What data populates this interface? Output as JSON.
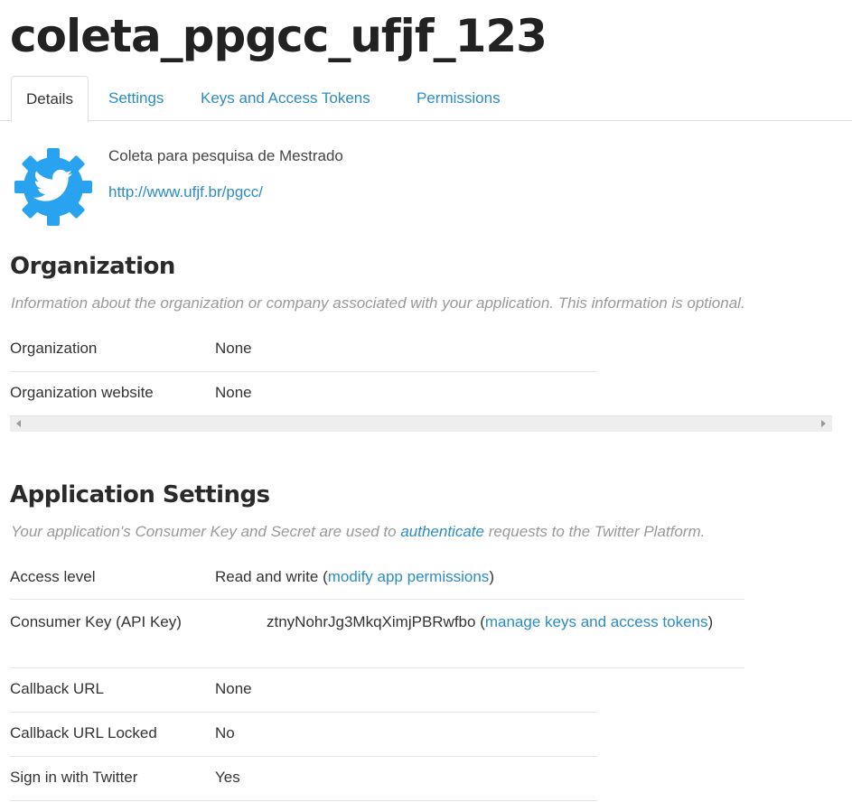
{
  "app": {
    "title": "coleta_ppgcc_ufjf_123"
  },
  "tabs": [
    {
      "label": "Details"
    },
    {
      "label": "Settings"
    },
    {
      "label": "Keys and Access Tokens"
    },
    {
      "label": "Permissions"
    }
  ],
  "details": {
    "description": "Coleta para pesquisa de Mestrado",
    "website": "http://www.ufjf.br/pgcc/",
    "logo_icon": "twitter-bird-gear-icon",
    "logo_color": "#29a3ef"
  },
  "organization": {
    "heading": "Organization",
    "note": "Information about the organization or company associated with your application. This information is optional.",
    "rows": [
      {
        "label": "Organization",
        "value": "None"
      },
      {
        "label": "Organization website",
        "value": "None"
      }
    ]
  },
  "app_settings": {
    "heading": "Application Settings",
    "note_before": "Your application's Consumer Key and Secret are used to ",
    "note_link": "authenticate",
    "note_after": " requests to the Twitter Platform.",
    "access_level": {
      "label": "Access level",
      "value": "Read and write",
      "paren_open": " (",
      "link": "modify app permissions",
      "paren_close": ")"
    },
    "consumer_key": {
      "label": "Consumer Key (API Key)",
      "value": "ztnyNohrJg3MkqXimjPBRwfbo",
      "paren_open": " (",
      "link": "manage keys and access tokens",
      "paren_close": ")"
    },
    "rows": [
      {
        "label": "Callback URL",
        "value": "None"
      },
      {
        "label": "Callback URL Locked",
        "value": "No"
      },
      {
        "label": "Sign in with Twitter",
        "value": "Yes"
      }
    ]
  },
  "colors": {
    "link": "#2b8cc4",
    "muted": "#999999",
    "text": "#333333"
  }
}
